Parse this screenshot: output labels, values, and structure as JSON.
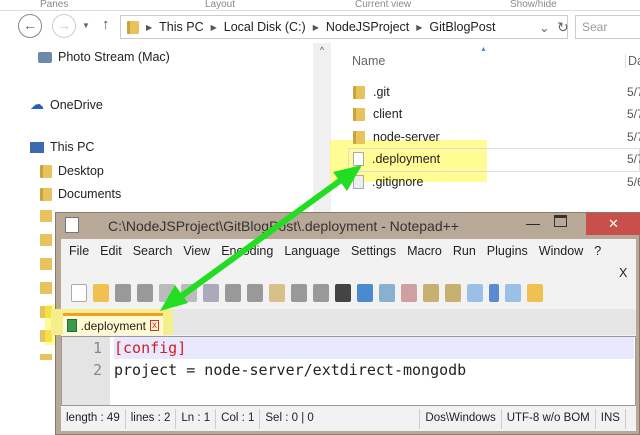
{
  "ribbon": [
    "Panes",
    "Layout",
    "Current view",
    "Show/hide"
  ],
  "address": {
    "crumbs": [
      "This PC",
      "Local Disk (C:)",
      "NodeJSProject",
      "GitBlogPost"
    ]
  },
  "search": {
    "placeholder": "Sear"
  },
  "nav_pane": [
    "Photo Stream (Mac)",
    "OneDrive",
    "This PC",
    "Desktop",
    "Documents"
  ],
  "file_list": {
    "header": "Name",
    "header2": "Da",
    "items": [
      {
        "name": ".git",
        "type": "folder",
        "date": "5/7"
      },
      {
        "name": "client",
        "type": "folder",
        "date": "5/7"
      },
      {
        "name": "node-server",
        "type": "folder",
        "date": "5/7"
      },
      {
        "name": ".deployment",
        "type": "file",
        "date": "5/7"
      },
      {
        "name": ".gitignore",
        "type": "file",
        "date": "5/6"
      }
    ]
  },
  "notepad": {
    "title": "C:\\NodeJSProject\\GitBlogPost\\.deployment - Notepad++",
    "menu": [
      "File",
      "Edit",
      "Search",
      "View",
      "Encoding",
      "Language",
      "Settings",
      "Macro",
      "Run",
      "Plugins",
      "Window",
      "?"
    ],
    "menu_close": "X",
    "tab": ".deployment",
    "lines": [
      {
        "n": "1",
        "text": "[config]"
      },
      {
        "n": "2",
        "text": "project = node-server/extdirect-mongodb"
      }
    ],
    "status": [
      "length : 49",
      "lines : 2",
      "Ln : 1",
      "Col : 1",
      "Sel : 0 | 0",
      "Dos\\Windows",
      "UTF-8 w/o BOM",
      "INS"
    ]
  },
  "colors": {
    "highlight": "#fffa3c",
    "arrow": "#22dd22",
    "titlebar": "#b8a898",
    "close": "#c9504a"
  }
}
